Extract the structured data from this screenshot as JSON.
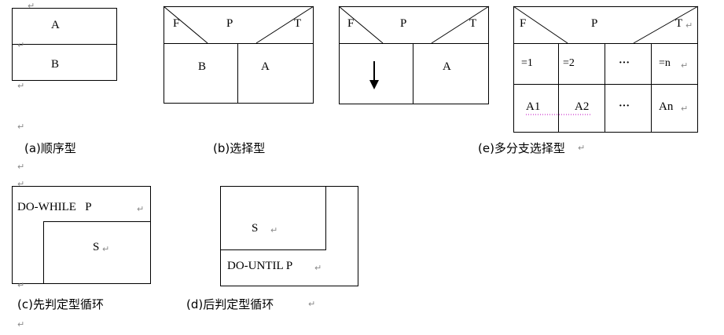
{
  "return_mark": "↵",
  "seq": {
    "top": "A",
    "bottom": "B",
    "caption": "(a)顺序型"
  },
  "sel": {
    "false_label": "F",
    "cond": "P",
    "true_label": "T",
    "left": "B",
    "right": "A",
    "caption": "(b)选择型"
  },
  "sel2": {
    "false_label": "F",
    "cond": "P",
    "true_label": "T",
    "right": "A",
    "left_icon": "down-arrow"
  },
  "multi": {
    "false_label": "F",
    "cond": "P",
    "true_label": "T",
    "cases": [
      "=1",
      "=2",
      "···",
      "=n"
    ],
    "actions": [
      "A1",
      "A2",
      "···",
      "An"
    ],
    "caption": "(e)多分支选择型"
  },
  "dowhile": {
    "header": "DO-WHILE   P",
    "body": "S",
    "caption": "(c)先判定型循环"
  },
  "dountil": {
    "body": "S",
    "footer": "DO-UNTIL P",
    "caption": "(d)后判定型循环"
  }
}
